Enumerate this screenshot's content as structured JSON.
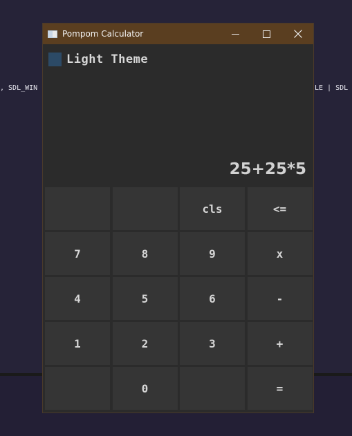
{
  "background": {
    "code_left": ", SDL_WIN",
    "code_right": "LE | SDL"
  },
  "window": {
    "title": "Pompom Calculator",
    "controls": {
      "minimize": "─",
      "maximize": "☐",
      "close": "✕"
    }
  },
  "theme": {
    "label": "Light Theme",
    "checked": false
  },
  "display": {
    "expression": "25+25*5"
  },
  "keys": [
    [
      "",
      "",
      "cls",
      "<="
    ],
    [
      "7",
      "8",
      "9",
      "x"
    ],
    [
      "4",
      "5",
      "6",
      "-"
    ],
    [
      "1",
      "2",
      "3",
      "+"
    ],
    [
      "",
      "0",
      "",
      "="
    ]
  ],
  "colors": {
    "titlebar": "#5a3e20",
    "window_bg": "#2b2b2b",
    "key_bg": "#353535",
    "checkbox": "#2c4a66",
    "desktop": "#262338"
  }
}
